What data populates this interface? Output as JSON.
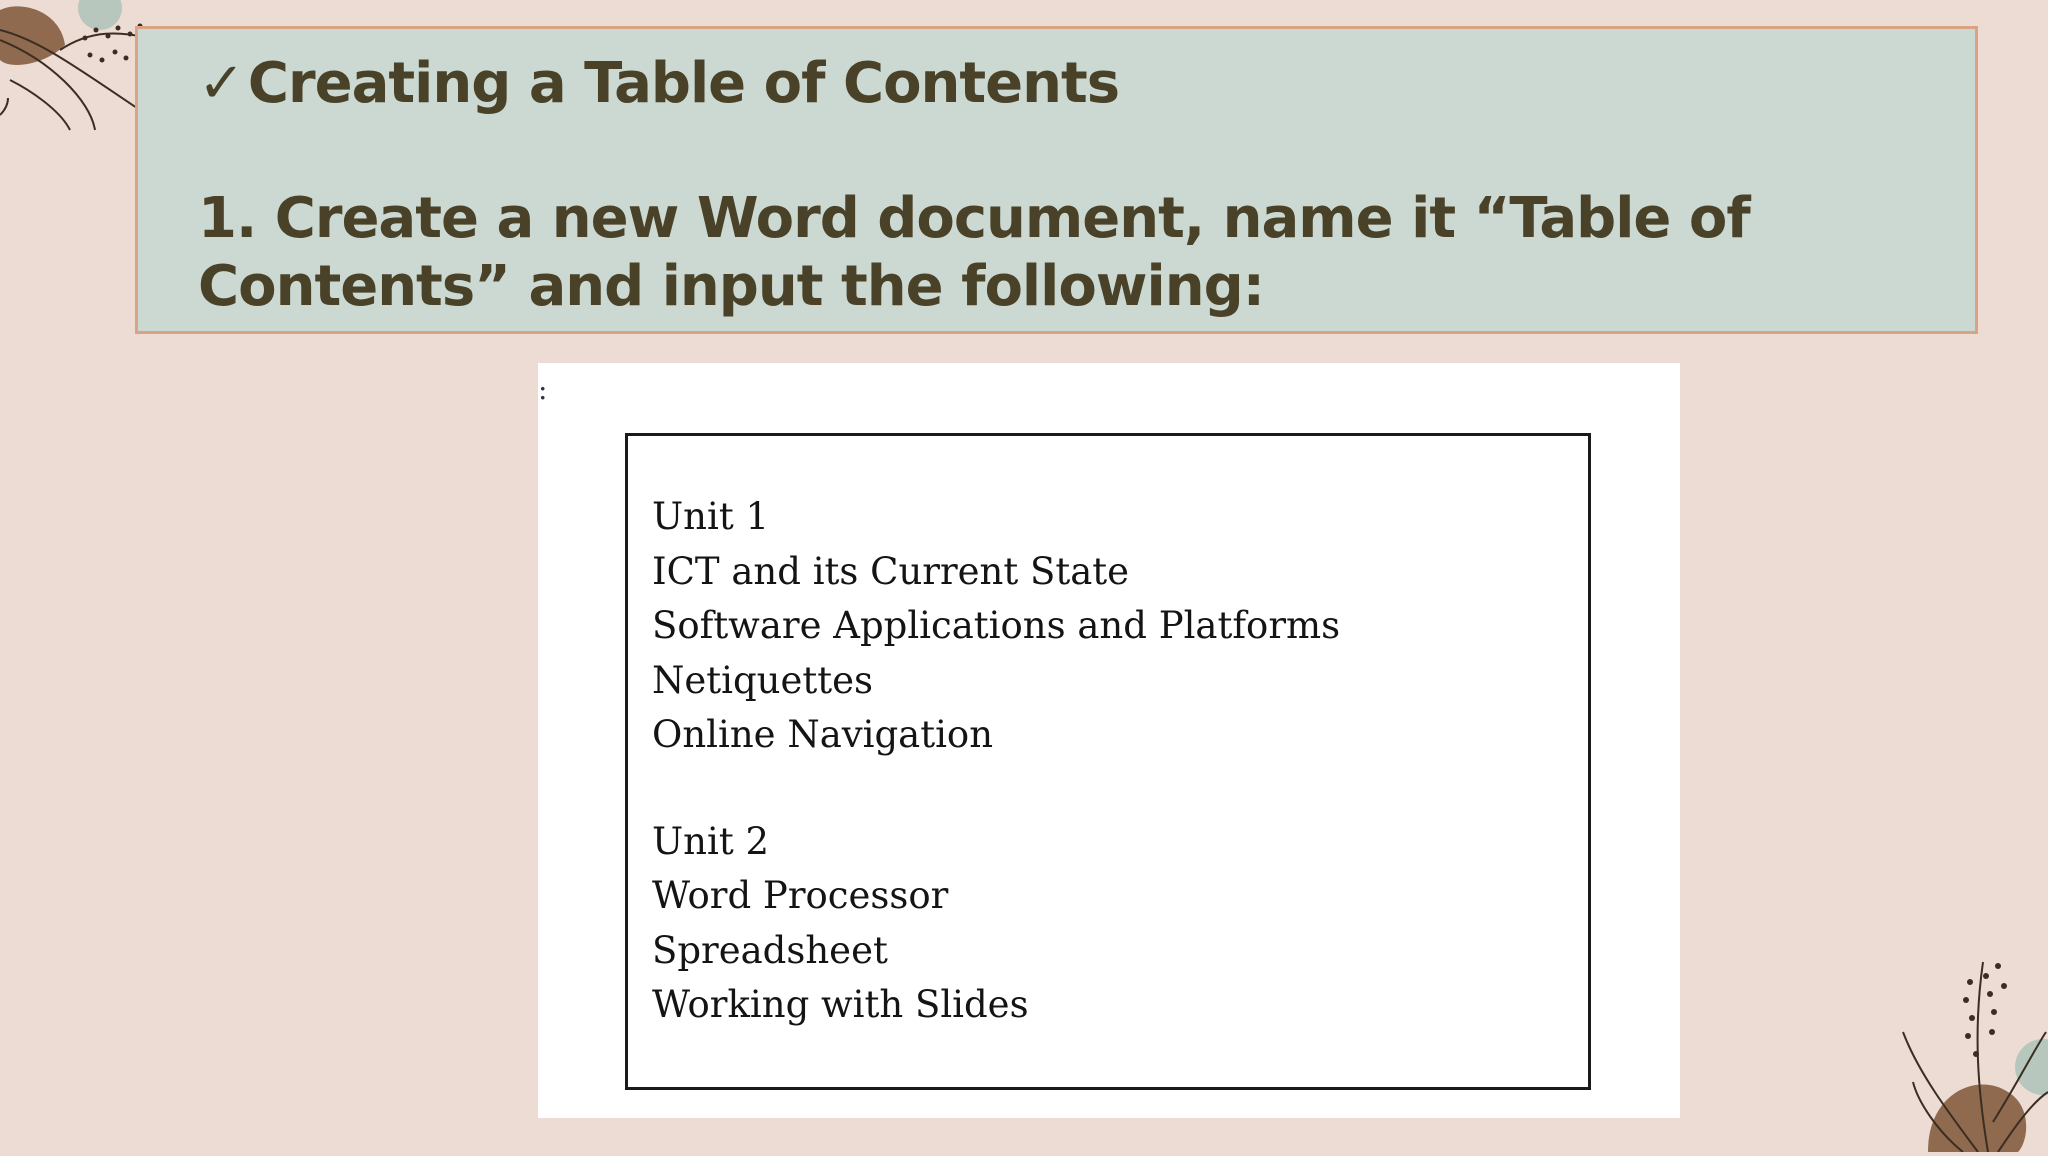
{
  "slide": {
    "heading_check": "✓",
    "heading": "Creating a Table of Contents",
    "instruction": "1. Create a new Word document, name it “Table of Contents” and input the following:"
  },
  "document_image": {
    "artifact": ":",
    "lines": [
      "Unit 1",
      "ICT and its Current State",
      "Software Applications and Platforms",
      "Netiquettes",
      "Online Navigation",
      "Unit 2",
      "Word Processor",
      "Spreadsheet",
      "Working with Slides"
    ]
  },
  "colors": {
    "background": "#ecdcd3",
    "header_fill": "#ccd9d2",
    "header_border": "#dba385",
    "text": "#4a4228"
  },
  "icons": {
    "top_left": "botanical-leaf-icon",
    "bottom_right": "botanical-leaf-icon"
  }
}
